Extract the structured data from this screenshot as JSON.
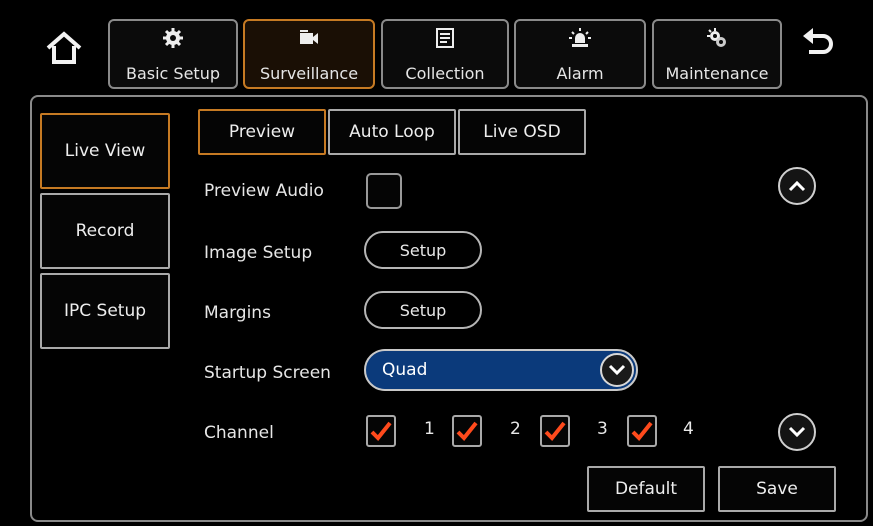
{
  "tabs": [
    {
      "label": "Basic Setup",
      "icon": "gear-icon",
      "active": false
    },
    {
      "label": "Surveillance",
      "icon": "camera-icon",
      "active": true
    },
    {
      "label": "Collection",
      "icon": "folder-icon",
      "active": false
    },
    {
      "label": "Alarm",
      "icon": "alarm-light-icon",
      "active": false
    },
    {
      "label": "Maintenance",
      "icon": "gears-icon",
      "active": false
    }
  ],
  "nav": {
    "home_icon": "home-icon",
    "back_icon": "back-arrow-icon"
  },
  "sidebar": {
    "items": [
      {
        "label": "Live View",
        "active": true
      },
      {
        "label": "Record",
        "active": false
      },
      {
        "label": "IPC Setup",
        "active": false
      }
    ]
  },
  "subtabs": [
    {
      "label": "Preview",
      "active": true
    },
    {
      "label": "Auto Loop",
      "active": false
    },
    {
      "label": "Live OSD",
      "active": false
    }
  ],
  "form": {
    "preview_audio": {
      "label": "Preview Audio",
      "checked": false
    },
    "image_setup": {
      "label": "Image Setup",
      "button": "Setup"
    },
    "margins": {
      "label": "Margins",
      "button": "Setup"
    },
    "startup_screen": {
      "label": "Startup Screen",
      "value": "Quad"
    },
    "channel": {
      "label": "Channel",
      "channels": [
        {
          "num": "1",
          "checked": true
        },
        {
          "num": "2",
          "checked": true
        },
        {
          "num": "3",
          "checked": true
        },
        {
          "num": "4",
          "checked": true
        }
      ]
    }
  },
  "actions": {
    "default_label": "Default",
    "save_label": "Save"
  },
  "colors": {
    "accent": "#c67a23",
    "select_bg": "#0b3a7b",
    "check": "#ff4a1c"
  }
}
